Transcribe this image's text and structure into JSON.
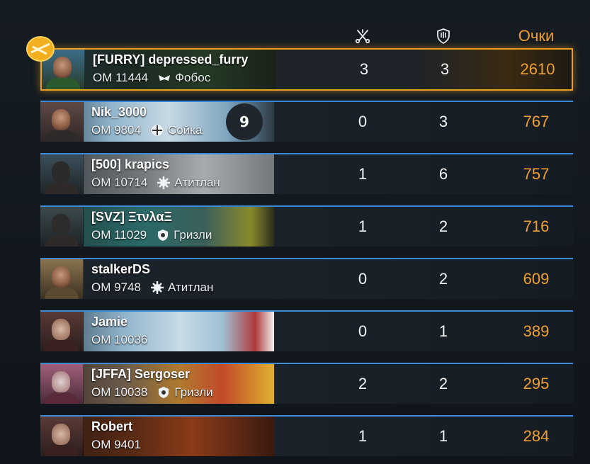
{
  "header": {
    "kills_icon": "crossed-swords-icon",
    "deaths_icon": "shield-icon",
    "score_label": "Очки"
  },
  "rows": [
    {
      "name": "[FURRY] depressed_furry",
      "rank": "ОМ 11444",
      "clan": "Фобос",
      "clan_icon": "mask-icon",
      "kills": "3",
      "deaths": "3",
      "score": "2610",
      "highlight": true,
      "banner": "#2b3a2e"
    },
    {
      "name": "Nik_3000",
      "rank": "ОМ 9804",
      "clan": "Сойка",
      "clan_icon": "crosshair-icon",
      "kills": "0",
      "deaths": "3",
      "score": "767",
      "badge": "9",
      "banner": "#6ea2c4"
    },
    {
      "name": "[500] krapics",
      "rank": "ОМ 10714",
      "clan": "Атитлан",
      "clan_icon": "gear-icon",
      "kills": "1",
      "deaths": "6",
      "score": "757",
      "banner": "#8a8e90"
    },
    {
      "name": "[SVZ] ΞτνλαΞ",
      "rank": "ОМ 11029",
      "clan": "Гризли",
      "clan_icon": "bear-shield-icon",
      "kills": "1",
      "deaths": "2",
      "score": "716",
      "banner": "#2b6a68"
    },
    {
      "name": "stalkerDS",
      "rank": "ОМ 9748",
      "clan": "Атитлан",
      "clan_icon": "gear-icon",
      "kills": "0",
      "deaths": "2",
      "score": "609",
      "banner": "#1e252c"
    },
    {
      "name": "Jamie",
      "rank": "ОМ 10036",
      "clan": "",
      "clan_icon": "",
      "kills": "0",
      "deaths": "1",
      "score": "389",
      "banner": "#7fa9c6"
    },
    {
      "name": "[JFFA] Sergoser",
      "rank": "ОМ 10038",
      "clan": "Гризли",
      "clan_icon": "bear-shield-icon",
      "kills": "2",
      "deaths": "2",
      "score": "295",
      "banner": "#b07a2e"
    },
    {
      "name": "Robert",
      "rank": "ОМ 9401",
      "clan": "",
      "clan_icon": "",
      "kills": "1",
      "deaths": "1",
      "score": "284",
      "banner": "#5a2a14"
    }
  ],
  "colors": {
    "accent": "#f0a030",
    "row_border": "#3d8ad6",
    "highlight": "#e9a020"
  }
}
